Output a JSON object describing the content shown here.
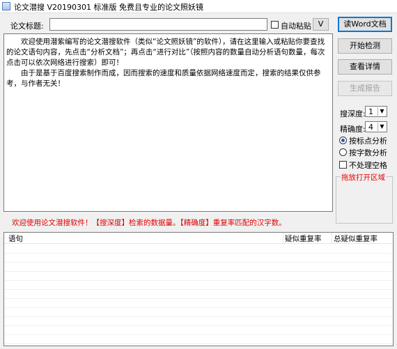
{
  "window": {
    "title": "论文潜搜 V20190301 标准版 免费且专业的论文照妖镜"
  },
  "toolbar": {
    "title_label": "论文标题:",
    "title_value": "",
    "auto_paste_label": "自动粘贴",
    "v_button": "V"
  },
  "main_text": {
    "paragraphs": [
      "欢迎使用潜紫编写的论文潜搜软件（类似“论文照妖镜”的软件），请在这里输入或粘贴你要查找的论文语句内容，先点击“分析文档”；再点击“进行对比”（按照内容的数量自动分析语句数量，每次点击可以依次网络进行搜索）即可！",
      "由于是基于百度搜索制作而成，因而搜索的速度和质量依据网络速度而定，搜索的结果仅供参考，与作者无关！"
    ]
  },
  "buttons": {
    "read_word": "读Word文档",
    "start_check": "开始检测",
    "view_detail": "查看详情",
    "gen_report": "生成报告"
  },
  "settings": {
    "depth_label": "搜深度:",
    "depth_value": "1",
    "precision_label": "精确度:",
    "precision_value": "4",
    "radio_punct": "按标点分析",
    "radio_count": "按字数分析",
    "no_space": "不处理空格",
    "drop_zone": "拖放打开区域"
  },
  "hint": "欢迎使用论文潜搜软件！【搜深度】检索的数据量。【精确度】重复率匹配的汉字数。",
  "grid": {
    "columns": [
      "语句",
      "疑似重复率",
      "总疑似重复率"
    ]
  },
  "colors": {
    "hint": "#e00000",
    "focus": "#0078d7"
  }
}
